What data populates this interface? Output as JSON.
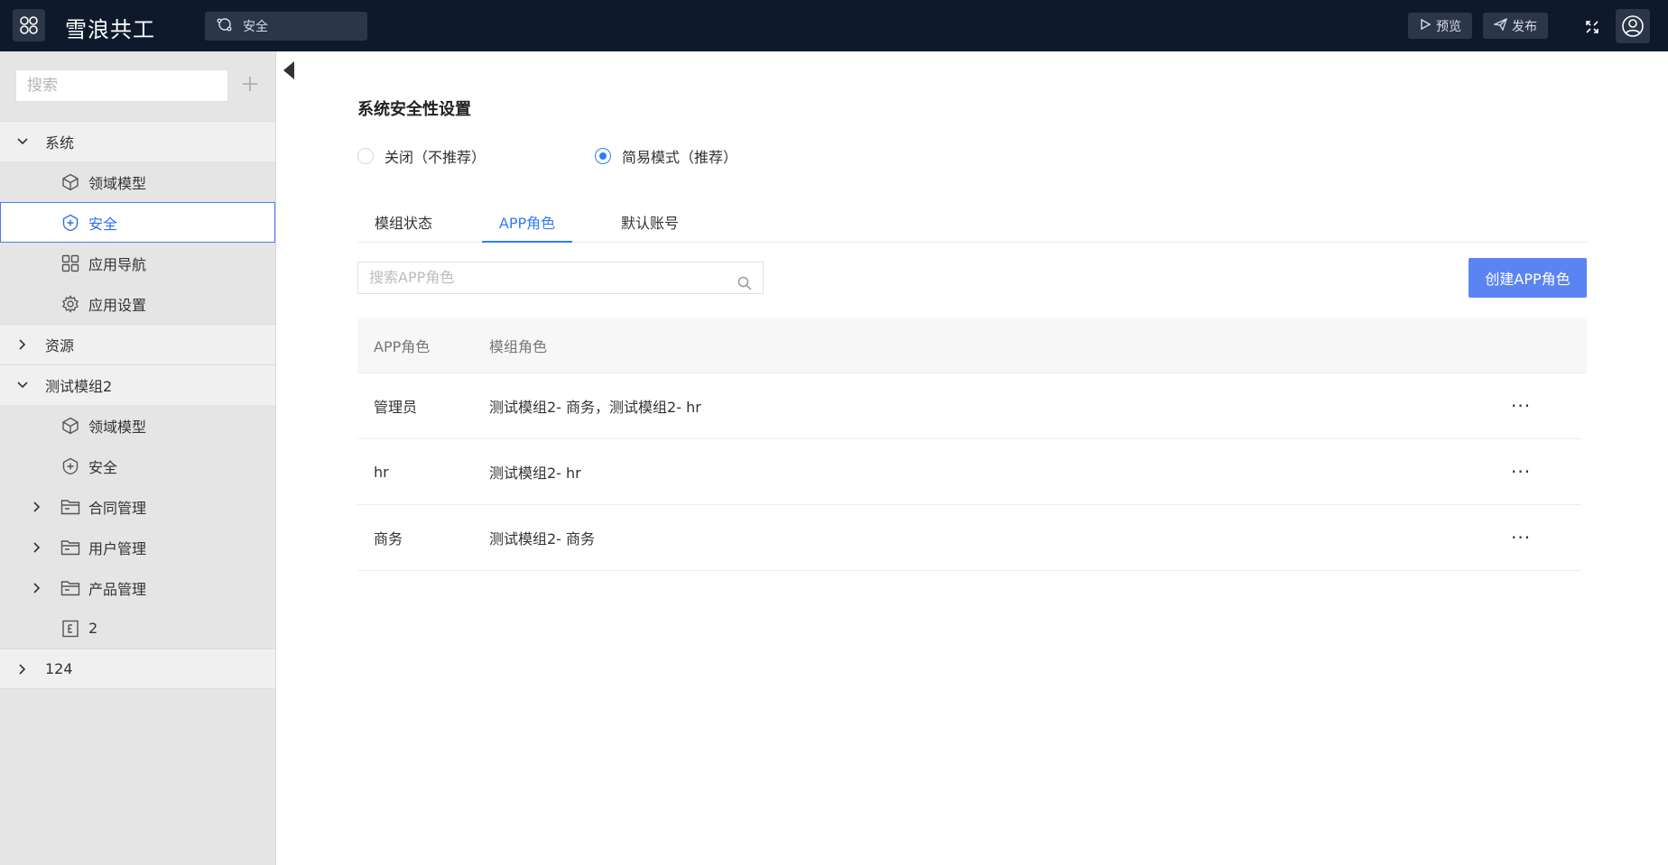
{
  "app": {
    "title": "雪浪共工"
  },
  "header": {
    "breadcrumb": "安全",
    "preview_label": "预览",
    "publish_label": "发布"
  },
  "sidebar": {
    "search_placeholder": "搜索",
    "groups": [
      {
        "label": "系统",
        "expanded": true,
        "items": [
          {
            "label": "领域模型",
            "icon": "cube-icon"
          },
          {
            "label": "安全",
            "icon": "shield-plus-icon",
            "active": true
          },
          {
            "label": "应用导航",
            "icon": "grid-icon"
          },
          {
            "label": "应用设置",
            "icon": "gear-icon"
          }
        ]
      },
      {
        "label": "资源",
        "expanded": false
      },
      {
        "label": "测试模组2",
        "expanded": true,
        "items": [
          {
            "label": "领域模型",
            "icon": "cube-icon"
          },
          {
            "label": "安全",
            "icon": "shield-plus-icon"
          },
          {
            "label": "合同管理",
            "icon": "folder-icon"
          },
          {
            "label": "用户管理",
            "icon": "folder-icon"
          },
          {
            "label": "产品管理",
            "icon": "folder-icon"
          },
          {
            "label": "2",
            "icon": "entity-icon"
          }
        ]
      },
      {
        "label": "124",
        "expanded": false
      }
    ]
  },
  "main": {
    "title": "系统安全性设置",
    "radio_options": [
      {
        "label": "关闭（不推荐）",
        "selected": false
      },
      {
        "label": "简易模式（推荐）",
        "selected": true
      }
    ],
    "tabs": [
      {
        "label": "模组状态",
        "active": false
      },
      {
        "label": "APP角色",
        "active": true
      },
      {
        "label": "默认账号",
        "active": false
      }
    ],
    "search_placeholder": "搜索APP角色",
    "create_button": "创建APP角色",
    "table": {
      "headers": [
        "APP角色",
        "模组角色"
      ],
      "rows": [
        {
          "app_role": "管理员",
          "module_roles": "测试模组2- 商务，测试模组2- hr",
          "more": "···"
        },
        {
          "app_role": "hr",
          "module_roles": "测试模组2- hr",
          "more": "···"
        },
        {
          "app_role": "商务",
          "module_roles": "测试模组2- 商务",
          "more": "···"
        }
      ]
    }
  },
  "colors": {
    "topbar": "#0e1a2c",
    "accent": "#2f7df6",
    "primary_button": "#5b84f3",
    "sidebar_bg": "#e5e5e5"
  }
}
